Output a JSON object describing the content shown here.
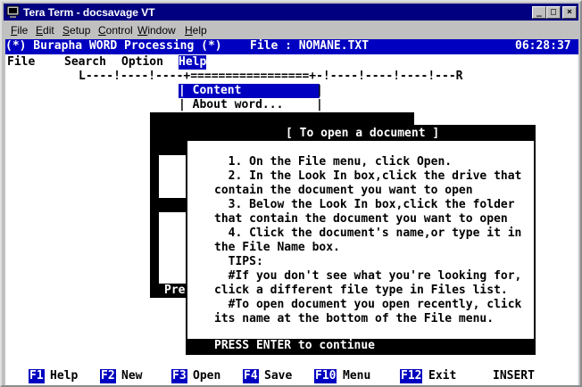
{
  "window": {
    "title": "Tera Term - docsavage VT",
    "controls": {
      "minimize": "_",
      "maximize": "□",
      "close": "×"
    }
  },
  "menubar": {
    "items": [
      {
        "label": "File",
        "underline": "F",
        "rest": "ile"
      },
      {
        "label": "Edit",
        "underline": "E",
        "rest": "dit"
      },
      {
        "label": "Setup",
        "underline": "S",
        "rest": "etup"
      },
      {
        "label": "Control",
        "underline": "C",
        "rest": "ontrol"
      },
      {
        "label": "Window",
        "underline": "W",
        "rest": "indow"
      },
      {
        "label": "Help",
        "underline": "H",
        "rest": "elp"
      }
    ]
  },
  "app": {
    "header_left": "(*) Burapha WORD Processing (*)",
    "header_file": "File : NOMANE.TXT",
    "clock": "06:28:37",
    "menu": {
      "file": "File",
      "search": "Search",
      "option": "Option",
      "help": "Help"
    },
    "ruler": "L----!----!----+=================+-!----!----!----!---R",
    "help_menu": {
      "item1": "| Content",
      "item1_bar": "|",
      "item2": "| About word...",
      "item2_bar": "|"
    },
    "bg_text": "Pre",
    "dialog": {
      "title": "[ To open a document ]",
      "lines": [
        "  1. On the File menu, click Open.",
        "  2. In the Look In box,click the drive that",
        "contain the document you want to open",
        "  3. Below the Look In box,click the folder",
        "that contain the document you want to open",
        "  4. Click the document's name,or type it in",
        "the File Name box.",
        "  TIPS:",
        "  #If you don't see what you're looking for,",
        "click a different file type in Files list.",
        "  #To open document you open recently, click",
        "its name at the bottom of the File menu."
      ],
      "footer": "PRESS ENTER to continue"
    },
    "fkeys": [
      {
        "key": "F1",
        "label": "Help"
      },
      {
        "key": "F2",
        "label": "New"
      },
      {
        "key": "F3",
        "label": "Open"
      },
      {
        "key": "F4",
        "label": "Save"
      },
      {
        "key": "F10",
        "label": "Menu"
      },
      {
        "key": "F12",
        "label": "Exit"
      }
    ],
    "status": "INSERT"
  }
}
